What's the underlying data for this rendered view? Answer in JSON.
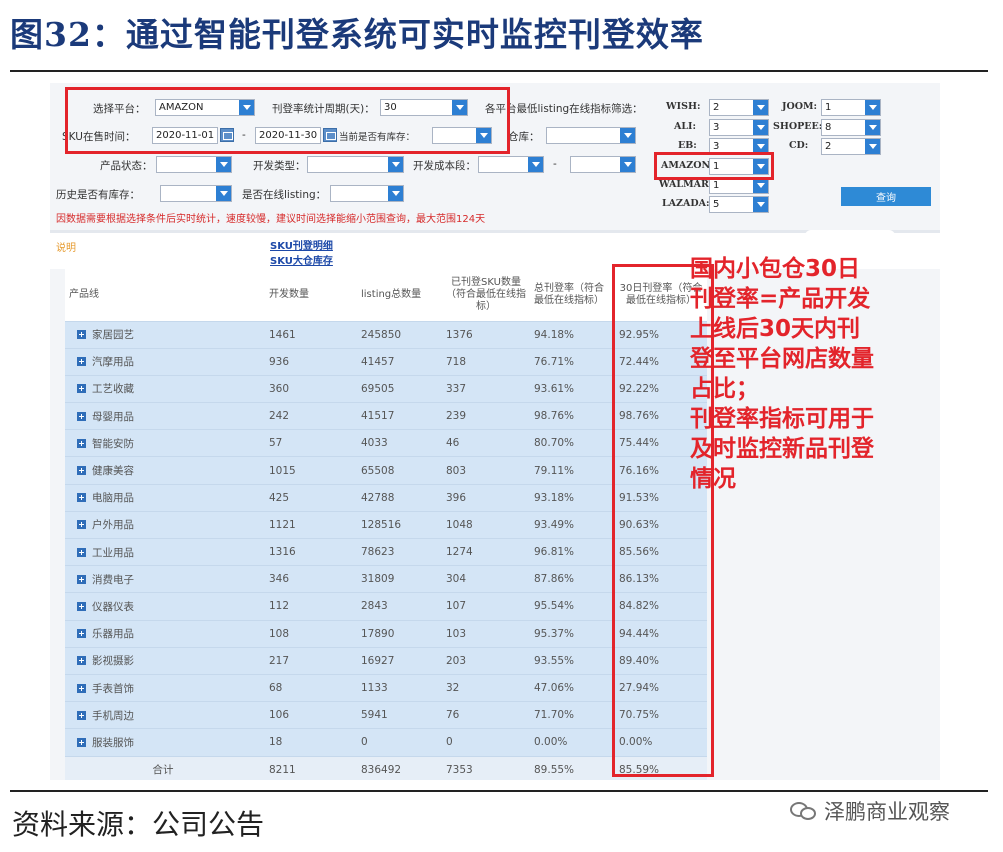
{
  "figure": {
    "title": "图32：通过智能刊登系统可实时监控刊登效率",
    "source": "资料来源：公司公告",
    "watermark": "泽鹏商业观察"
  },
  "filters": {
    "platform_label": "选择平台：",
    "platform_value": "AMAZON",
    "period_label": "刊登率统计周期(天)：",
    "period_value": "30",
    "platform_filter_label": "各平台最低listing在线指标筛选：",
    "sku_time_label": "SKU在售时间：",
    "date_from": "2020-11-01",
    "date_sep": "-",
    "date_to": "2020-11-30",
    "stock_label": "当前是否有库存：",
    "warehouse_label": "仓库：",
    "product_status_label": "产品状态：",
    "dev_type_label": "开发类型：",
    "dev_cost_label": "开发成本段：",
    "cost_sep": "-",
    "history_stock_label": "历史是否有库存：",
    "online_listing_label": "是否在线listing：",
    "warning": "因数据需要根据选择条件后实时统计，速度较慢，建议时间选择能缩小范围查询，最大范围124天",
    "query_button": "查询"
  },
  "platform_min": {
    "wish_label": "WISH:",
    "wish": "2",
    "ali_label": "ALI:",
    "ali": "3",
    "eb_label": "EB:",
    "eb": "3",
    "amazon_label": "AMAZON:",
    "amazon": "1",
    "walmart_label": "WALMART:",
    "walmart": "1",
    "lazada_label": "LAZADA:",
    "lazada": "5",
    "joom_label": "JOOM:",
    "joom": "1",
    "shopee_label": "SHOPEE:",
    "shopee": "8",
    "cd_label": "CD:",
    "cd": "2"
  },
  "links": {
    "note": "说明",
    "sku_detail": "SKU刊登明细",
    "sku_stock": "SKU大仓库存"
  },
  "table": {
    "headers": [
      "产品线",
      "开发数量",
      "listing总数量",
      "已刊登SKU数量（符合最低在线指标）",
      "总刊登率（符合最低在线指标）",
      "30日刊登率（符合最低在线指标）"
    ],
    "rows": [
      [
        "家居园艺",
        "1461",
        "245850",
        "1376",
        "94.18%",
        "92.95%"
      ],
      [
        "汽摩用品",
        "936",
        "41457",
        "718",
        "76.71%",
        "72.44%"
      ],
      [
        "工艺收藏",
        "360",
        "69505",
        "337",
        "93.61%",
        "92.22%"
      ],
      [
        "母婴用品",
        "242",
        "41517",
        "239",
        "98.76%",
        "98.76%"
      ],
      [
        "智能安防",
        "57",
        "4033",
        "46",
        "80.70%",
        "75.44%"
      ],
      [
        "健康美容",
        "1015",
        "65508",
        "803",
        "79.11%",
        "76.16%"
      ],
      [
        "电脑用品",
        "425",
        "42788",
        "396",
        "93.18%",
        "91.53%"
      ],
      [
        "户外用品",
        "1121",
        "128516",
        "1048",
        "93.49%",
        "90.63%"
      ],
      [
        "工业用品",
        "1316",
        "78623",
        "1274",
        "96.81%",
        "85.56%"
      ],
      [
        "消费电子",
        "346",
        "31809",
        "304",
        "87.86%",
        "86.13%"
      ],
      [
        "仪器仪表",
        "112",
        "2843",
        "107",
        "95.54%",
        "84.82%"
      ],
      [
        "乐器用品",
        "108",
        "17890",
        "103",
        "95.37%",
        "94.44%"
      ],
      [
        "影视摄影",
        "217",
        "16927",
        "203",
        "93.55%",
        "89.40%"
      ],
      [
        "手表首饰",
        "68",
        "1133",
        "32",
        "47.06%",
        "27.94%"
      ],
      [
        "手机周边",
        "106",
        "5941",
        "76",
        "71.70%",
        "70.75%"
      ],
      [
        "服装服饰",
        "18",
        "0",
        "0",
        "0.00%",
        "0.00%"
      ]
    ],
    "total": [
      "合计",
      "8211",
      "836492",
      "7353",
      "89.55%",
      "85.59%"
    ]
  },
  "annotation": {
    "lines": [
      "国内小包仓30日",
      "刊登率=产品开发",
      "上线后30天内刊",
      "登至平台网店数量",
      "占比；",
      "刊登率指标可用于",
      "及时监控新品刊登",
      "情况"
    ]
  },
  "colors": {
    "highlight_red": "#e3242b",
    "title_blue": "#1b3a7a",
    "table_row": "#d4e5f6",
    "select_arrow": "#2d7fd3"
  }
}
